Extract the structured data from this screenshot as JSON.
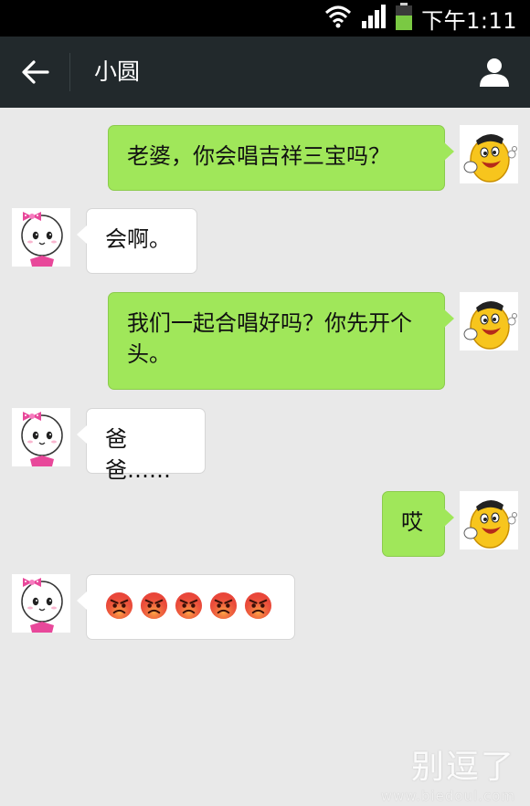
{
  "status_bar": {
    "time": "下午1:11",
    "icons": [
      "wifi-icon",
      "signal-icon",
      "battery-icon"
    ],
    "battery_color": "#7ac943"
  },
  "header": {
    "title": "小圆",
    "back_icon": "arrow-left-icon",
    "profile_icon": "person-icon",
    "background": "#22292c"
  },
  "messages": [
    {
      "sender": "me",
      "text": "老婆，你会唱吉祥三宝吗？"
    },
    {
      "sender": "other",
      "text": "会啊。"
    },
    {
      "sender": "me",
      "text": "我们一起合唱好吗？你先开个头。"
    },
    {
      "sender": "other",
      "text": "爸爸……"
    },
    {
      "sender": "me",
      "text": "哎"
    },
    {
      "sender": "other",
      "emoji": "angry-face-icon",
      "emoji_count": 5
    }
  ],
  "colors": {
    "sent_bubble": "#a0e75a",
    "received_bubble": "#ffffff",
    "chat_background": "#e9e9e9"
  },
  "watermark": {
    "title": "别逗了",
    "url": "www.biedoul.com"
  }
}
